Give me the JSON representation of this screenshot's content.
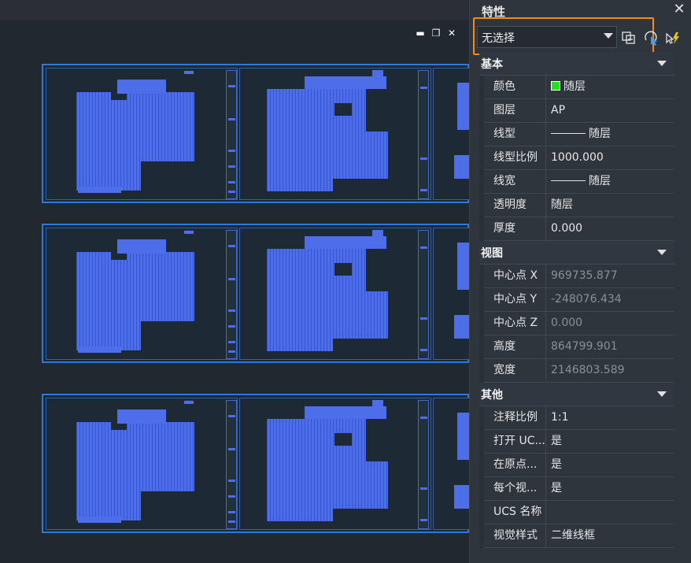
{
  "panel": {
    "title": "特性",
    "selector": {
      "value": "无选择"
    },
    "tools": [
      "toggle-pickadd-icon",
      "select-objects-icon",
      "quick-select-icon"
    ]
  },
  "groups": [
    {
      "title": "基本",
      "rows": [
        {
          "name": "颜色",
          "value": "随层",
          "swatch": "#22e022"
        },
        {
          "name": "图层",
          "value": "AP"
        },
        {
          "name": "线型",
          "value": "随层",
          "line": true
        },
        {
          "name": "线型比例",
          "value": "1000.000"
        },
        {
          "name": "线宽",
          "value": "随层",
          "line": true
        },
        {
          "name": "透明度",
          "value": "随层"
        },
        {
          "name": "厚度",
          "value": "0.000"
        }
      ]
    },
    {
      "title": "视图",
      "rows": [
        {
          "name": "中心点 X",
          "value": "969735.877",
          "readonly": true
        },
        {
          "name": "中心点 Y",
          "value": "-248076.434",
          "readonly": true
        },
        {
          "name": "中心点 Z",
          "value": "0.000",
          "readonly": true
        },
        {
          "name": "高度",
          "value": "864799.901",
          "readonly": true
        },
        {
          "name": "宽度",
          "value": "2146803.589",
          "readonly": true
        }
      ]
    },
    {
      "title": "其他",
      "rows": [
        {
          "name": "注释比例",
          "value": "1:1"
        },
        {
          "name": "打开 UC...",
          "value": "是"
        },
        {
          "name": "在原点...",
          "value": "是"
        },
        {
          "name": "每个视...",
          "value": "是"
        },
        {
          "name": "UCS 名称",
          "value": ""
        },
        {
          "name": "视觉样式",
          "value": "二维线框"
        }
      ]
    }
  ],
  "canvas": {
    "window_controls": [
      "minimize-icon",
      "restore-icon",
      "close-icon"
    ],
    "sheet_rows": 3,
    "accent": "#2d78d8",
    "drawing_color": "#4d6ee8"
  },
  "colors": {
    "highlight": "#f08a1c",
    "panel_bg": "#2f353d",
    "canvas_bg": "#212830"
  }
}
